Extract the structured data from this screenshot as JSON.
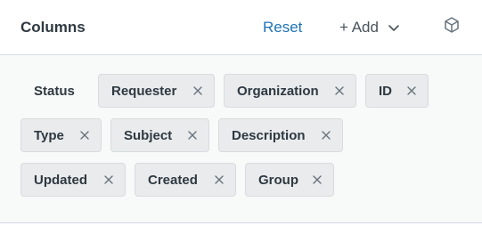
{
  "header": {
    "title": "Columns",
    "reset_label": "Reset",
    "add_label": "+ Add"
  },
  "columns": [
    {
      "label": "Status",
      "removable": false
    },
    {
      "label": "Requester",
      "removable": true
    },
    {
      "label": "Organization",
      "removable": true
    },
    {
      "label": "ID",
      "removable": true
    },
    {
      "label": "Type",
      "removable": true
    },
    {
      "label": "Subject",
      "removable": true
    },
    {
      "label": "Description",
      "removable": true
    },
    {
      "label": "Updated",
      "removable": true
    },
    {
      "label": "Created",
      "removable": true
    },
    {
      "label": "Group",
      "removable": true
    }
  ],
  "icons": {
    "remove": "close-icon",
    "add_menu": "chevron-down-icon",
    "cube": "cube-icon"
  },
  "colors": {
    "accent": "#1f73b7",
    "chip_bg": "#e9ebed",
    "text": "#2f3941"
  }
}
